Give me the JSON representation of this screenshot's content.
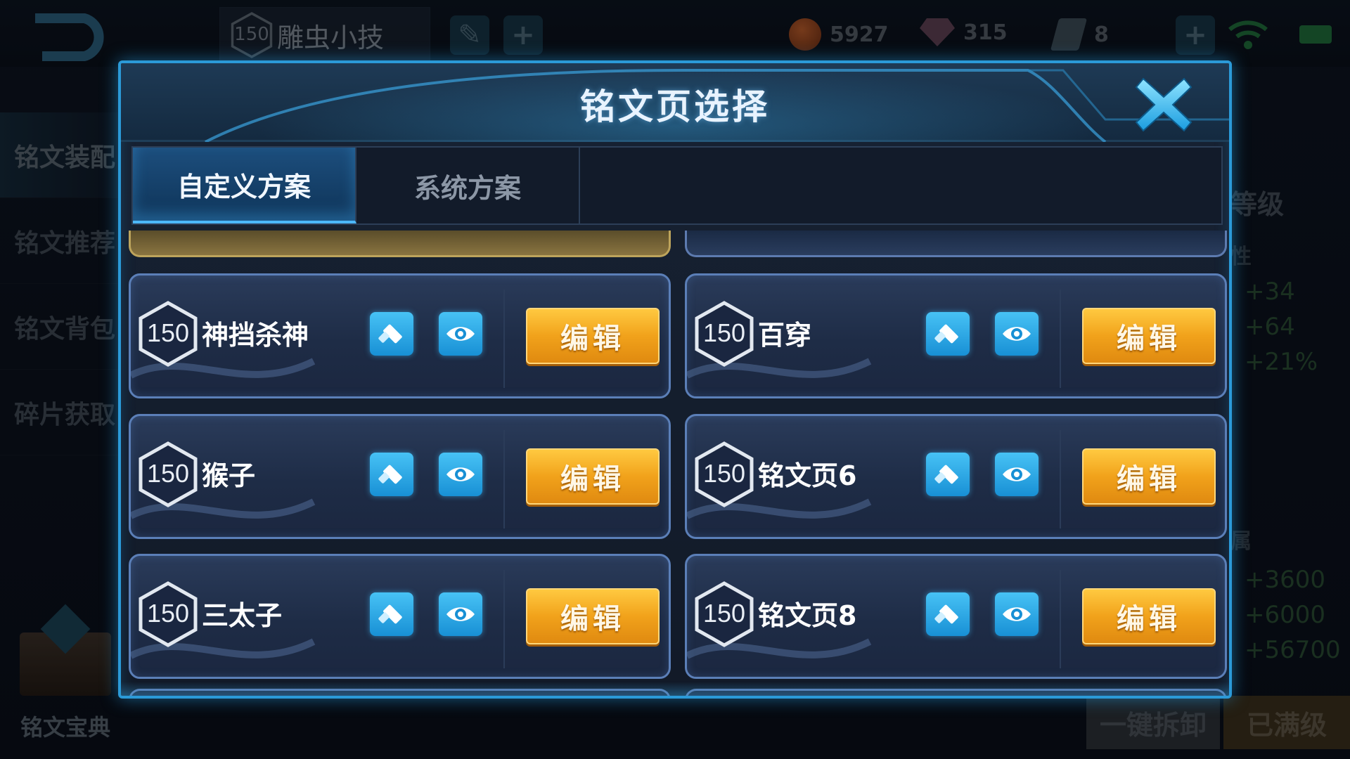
{
  "topbar": {
    "player_level": "150",
    "player_name": "雕虫小技",
    "gold": "5927",
    "diamonds": "315",
    "tickets": "8"
  },
  "leftnav": {
    "items": [
      "铭文装配",
      "铭文推荐",
      "铭文背包",
      "碎片获取"
    ],
    "codex_label": "铭文宝典"
  },
  "rightpanel": {
    "level_label": "等级",
    "attr_label": "性",
    "stats_top": [
      "+34",
      "+64",
      "+21%"
    ],
    "attr2_label": "属",
    "stats_bottom": [
      "+3600",
      "+6000",
      "+56700"
    ],
    "dismount_label": "一键拆卸",
    "maxed_label": "已满级"
  },
  "modal": {
    "title": "铭文页选择",
    "tabs": [
      "自定义方案",
      "系统方案"
    ],
    "edit_label": "编辑",
    "pages": [
      {
        "level": "150",
        "name": "神挡杀神"
      },
      {
        "level": "150",
        "name": "百穿"
      },
      {
        "level": "150",
        "name": "猴子"
      },
      {
        "level": "150",
        "name": "铭文页6"
      },
      {
        "level": "150",
        "name": "三太子"
      },
      {
        "level": "150",
        "name": "铭文页8"
      }
    ]
  },
  "colors": {
    "accent": "#2b9ad8",
    "edit_button": "#f1a21b",
    "icon_button": "#1890d5"
  }
}
